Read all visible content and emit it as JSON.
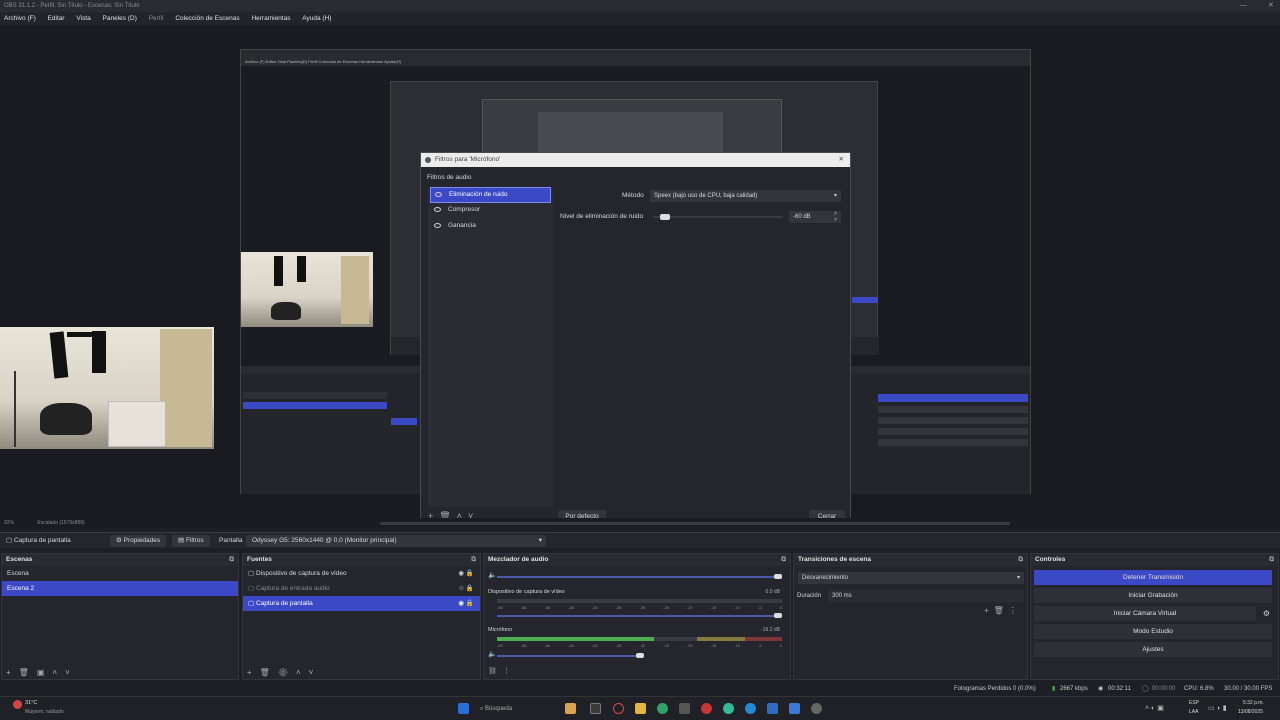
{
  "window": {
    "title": "OBS 31.1.2 - Perfil: Sin Título - Escenas: Sin Título"
  },
  "menu": [
    "Archivo (F)",
    "Editar",
    "Vista",
    "Paneles (D)",
    "Perfil",
    "Colección de Escenas",
    "Herramientas",
    "Ayuda (H)"
  ],
  "nested_menu": "Archivo (F)   Editar   Vista   Paneles(D)   Perfil   Colección de Escenas   Herramientas   Ayuda(H)",
  "dialog": {
    "title": "Filtros para 'Micrófono'",
    "section": "Filtros de audio",
    "filters": [
      "Eliminación de ruido",
      "Compresor",
      "Ganancia"
    ],
    "method_label": "Método",
    "method_value": "Speex (bajo uso de CPU, baja calidad)",
    "noise_label": "Nivel de eliminación de ruido",
    "noise_value": "-60 dB",
    "noise_level_fraction": 0.05,
    "default_button": "Por defecto",
    "close_button": "Cerrar"
  },
  "zoom": {
    "percent": "92%",
    "scale": "Escalado (1579x888)"
  },
  "sourcebar": {
    "source": "Captura de pantalla",
    "properties": "Propiedades",
    "filters": "Filtros",
    "screen_label": "Pantalla",
    "screen_value": "Odyssey G5: 2560x1440 @ 0,0 (Monitor principal)"
  },
  "scenes": {
    "title": "Escenas",
    "items": [
      "Escena",
      "Escena 2"
    ],
    "selected": 1
  },
  "sources": {
    "title": "Fuentes",
    "items": [
      "Dispositivo de captura de vídeo",
      "Captura de entrada audio",
      "Captura de pantalla"
    ],
    "selected": 2
  },
  "mixer": {
    "title": "Mezclador de audio",
    "channels": [
      {
        "name": "Dispositivo de captura de vídeo",
        "db": "0.0 dB"
      },
      {
        "name": "Micrófono",
        "db": "-19.2 dB",
        "level": 0.55
      }
    ],
    "ticks": [
      "-60",
      "-55",
      "-50",
      "-45",
      "-40",
      "-35",
      "-30",
      "-25",
      "-20",
      "-15",
      "-10",
      "-5",
      "0"
    ]
  },
  "transitions": {
    "title": "Transiciones de escena",
    "type": "Desvanecimiento",
    "duration_label": "Duración",
    "duration_value": "300 ms"
  },
  "controls": {
    "title": "Controles",
    "buttons": [
      "Detener Transmisión",
      "Iniciar Grabación",
      "Iniciar Cámara Virtual",
      "Modo Estudio",
      "Ajustes"
    ]
  },
  "status": {
    "dropped": "Fotogramas Perdidos 0 (0.0%)",
    "bitrate": "2667 kbps",
    "live_time": "00:32:11",
    "rec_time": "00:00:00",
    "cpu": "CPU: 6.8%",
    "fps": "30.00 / 30.00 FPS"
  },
  "taskbar": {
    "weather_temp": "31°C",
    "weather_text": "Mayorm. nublado",
    "search": "Búsqueda",
    "lang1": "ESP",
    "lang2": "LAA",
    "time": "5:32 p.m.",
    "date": "13/08/2025"
  }
}
